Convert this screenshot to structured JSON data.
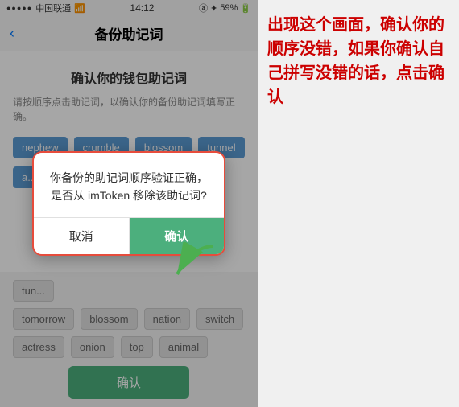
{
  "statusBar": {
    "dots": "●●●●●",
    "carrier": "中国联通",
    "wifi": "▾",
    "time": "14:12",
    "icons": "ⓐ ✦",
    "battery": "59%"
  },
  "navBar": {
    "backIcon": "‹",
    "title": "备份助记词"
  },
  "page": {
    "title": "确认你的钱包助记词",
    "subtitle": "请按顺序点击助记词，以确认你的备份助记词填写正确。"
  },
  "wordRows": [
    [
      "nephew",
      "crumble",
      "blossom",
      "tunnel"
    ],
    [
      "a..."
    ],
    [
      "tun...",
      ""
    ],
    [
      "tomorrow",
      "blossom",
      "nation",
      "switch"
    ],
    [
      "actress",
      "onion",
      "top",
      "animal"
    ]
  ],
  "dialog": {
    "text": "你备份的助记词顺序验证正确，是否从 imToken 移除该助记词?",
    "cancelLabel": "取消",
    "confirmLabel": "确认"
  },
  "bottomConfirmLabel": "确认",
  "annotation": {
    "text": "出现这个画面，确认你的顺序没错，如果你确认自己拼写没错的话，点击确认"
  }
}
